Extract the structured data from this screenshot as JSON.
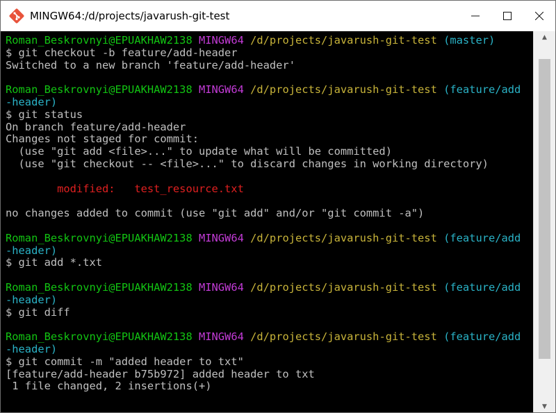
{
  "window": {
    "title": "MINGW64:/d/projects/javarush-git-test",
    "controls": {
      "minimize": "—",
      "maximize": "☐",
      "close": "✕"
    }
  },
  "terminal": {
    "lines": [
      [
        {
          "t": "Roman_Beskrovnyi@EPUAKHAW2138 ",
          "c": "user"
        },
        {
          "t": "MINGW64 ",
          "c": "host"
        },
        {
          "t": "/d/projects/javarush-git-test ",
          "c": "path"
        },
        {
          "t": "(master)",
          "c": "branch"
        }
      ],
      [
        {
          "t": "$ git checkout -b feature/add-header",
          "c": "fg"
        }
      ],
      [
        {
          "t": "Switched to a new branch 'feature/add-header'",
          "c": "fg"
        }
      ],
      [
        {
          "t": "",
          "c": "fg"
        }
      ],
      [
        {
          "t": "Roman_Beskrovnyi@EPUAKHAW2138 ",
          "c": "user"
        },
        {
          "t": "MINGW64 ",
          "c": "host"
        },
        {
          "t": "/d/projects/javarush-git-test ",
          "c": "path"
        },
        {
          "t": "(feature/add",
          "c": "branch"
        }
      ],
      [
        {
          "t": "-header)",
          "c": "branch"
        }
      ],
      [
        {
          "t": "$ git status",
          "c": "fg"
        }
      ],
      [
        {
          "t": "On branch feature/add-header",
          "c": "fg"
        }
      ],
      [
        {
          "t": "Changes not staged for commit:",
          "c": "fg"
        }
      ],
      [
        {
          "t": "  (use \"git add <file>...\" to update what will be committed)",
          "c": "fg"
        }
      ],
      [
        {
          "t": "  (use \"git checkout -- <file>...\" to discard changes in working directory)",
          "c": "fg"
        }
      ],
      [
        {
          "t": "",
          "c": "fg"
        }
      ],
      [
        {
          "t": "        modified:   test_resource.txt",
          "c": "red"
        }
      ],
      [
        {
          "t": "",
          "c": "fg"
        }
      ],
      [
        {
          "t": "no changes added to commit (use \"git add\" and/or \"git commit -a\")",
          "c": "fg"
        }
      ],
      [
        {
          "t": "",
          "c": "fg"
        }
      ],
      [
        {
          "t": "Roman_Beskrovnyi@EPUAKHAW2138 ",
          "c": "user"
        },
        {
          "t": "MINGW64 ",
          "c": "host"
        },
        {
          "t": "/d/projects/javarush-git-test ",
          "c": "path"
        },
        {
          "t": "(feature/add",
          "c": "branch"
        }
      ],
      [
        {
          "t": "-header)",
          "c": "branch"
        }
      ],
      [
        {
          "t": "$ git add *.txt",
          "c": "fg"
        }
      ],
      [
        {
          "t": "",
          "c": "fg"
        }
      ],
      [
        {
          "t": "Roman_Beskrovnyi@EPUAKHAW2138 ",
          "c": "user"
        },
        {
          "t": "MINGW64 ",
          "c": "host"
        },
        {
          "t": "/d/projects/javarush-git-test ",
          "c": "path"
        },
        {
          "t": "(feature/add",
          "c": "branch"
        }
      ],
      [
        {
          "t": "-header)",
          "c": "branch"
        }
      ],
      [
        {
          "t": "$ git diff",
          "c": "fg"
        }
      ],
      [
        {
          "t": "",
          "c": "fg"
        }
      ],
      [
        {
          "t": "Roman_Beskrovnyi@EPUAKHAW2138 ",
          "c": "user"
        },
        {
          "t": "MINGW64 ",
          "c": "host"
        },
        {
          "t": "/d/projects/javarush-git-test ",
          "c": "path"
        },
        {
          "t": "(feature/add",
          "c": "branch"
        }
      ],
      [
        {
          "t": "-header)",
          "c": "branch"
        }
      ],
      [
        {
          "t": "$ git commit -m \"added header to txt\"",
          "c": "fg"
        }
      ],
      [
        {
          "t": "[feature/add-header b75b972] added header to txt",
          "c": "fg"
        }
      ],
      [
        {
          "t": " 1 file changed, 2 insertions(+)",
          "c": "fg"
        }
      ]
    ]
  },
  "scrollbar": {
    "up_arrow": "▲",
    "down_arrow": "▼"
  },
  "colors": {
    "user": "#12c412",
    "host": "#c23bd6",
    "path": "#c8b43a",
    "branch": "#2ab3c7",
    "red": "#e02020",
    "fg": "#c0c0c0",
    "background": "#000000"
  },
  "icons": {
    "app": "git-bash-icon"
  }
}
